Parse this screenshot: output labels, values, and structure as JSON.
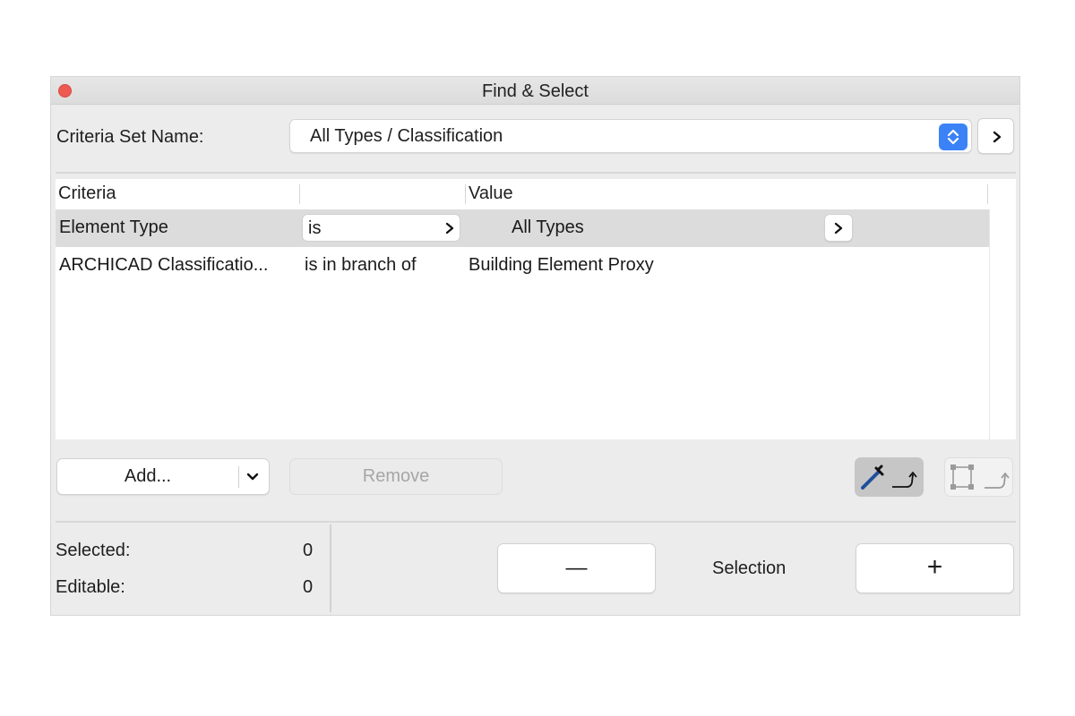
{
  "window": {
    "title": "Find & Select"
  },
  "criteria_set": {
    "label": "Criteria Set Name:",
    "value": "All Types / Classification"
  },
  "table": {
    "headers": [
      "Criteria",
      "",
      "Value"
    ],
    "rows": [
      {
        "criteria": "Element Type",
        "operator": "is",
        "value": "All Types",
        "selected": true
      },
      {
        "criteria": "ARCHICAD Classificatio...",
        "operator": "is in branch of",
        "value": "Building Element Proxy",
        "selected": false
      }
    ]
  },
  "buttons": {
    "add": "Add...",
    "remove": "Remove"
  },
  "status": {
    "selected_label": "Selected:",
    "selected_value": "0",
    "editable_label": "Editable:",
    "editable_value": "0"
  },
  "selection": {
    "minus": "—",
    "label": "Selection",
    "plus": "+"
  },
  "icons": {
    "close": "close-dot",
    "stepper": "up-down-chevron-icon",
    "chevron": "chevron-right-icon",
    "eyedropper": "eyedropper-icon",
    "marquee": "marquee-icon"
  },
  "colors": {
    "accent": "#3b82f6",
    "close": "#ee5a52",
    "row_selected": "#dcdcdc",
    "window_bg": "#ececec"
  }
}
